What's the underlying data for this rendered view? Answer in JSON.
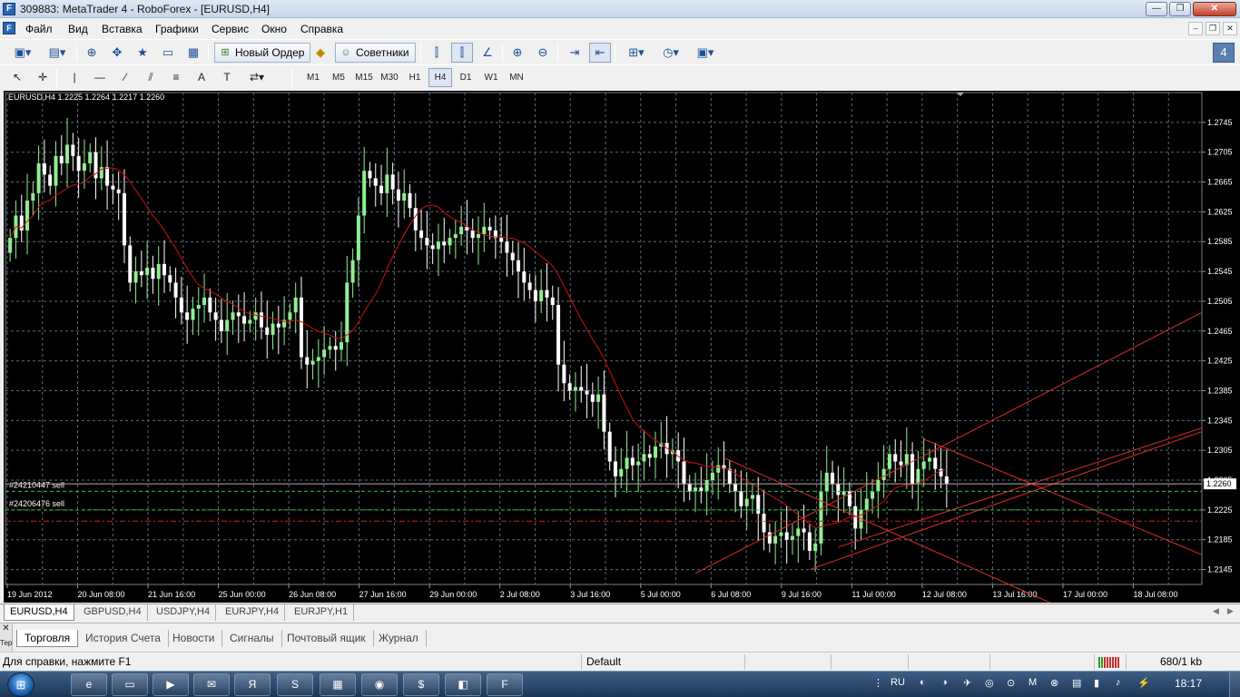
{
  "window": {
    "title": "309883: MetaTrader 4 - RoboForex - [EURUSD,H4]",
    "app_icon": "metatrader-icon"
  },
  "menu": [
    "Файл",
    "Вид",
    "Вставка",
    "Графики",
    "Сервис",
    "Окно",
    "Справка"
  ],
  "toolbar": {
    "new_order_label": "Новый Ордер",
    "advisors_label": "Советники"
  },
  "timeframes": {
    "items": [
      "M1",
      "M5",
      "M15",
      "M30",
      "H1",
      "H4",
      "D1",
      "W1",
      "MN"
    ],
    "active": "H4"
  },
  "chart": {
    "symbol_info": "EURUSD,H4  1.2225 1.2264 1.2217 1.2260",
    "current_price_label": "1.2260",
    "order_labels": [
      "#24210447 sell",
      "#24206476 sell"
    ],
    "colors": {
      "background": "#000000",
      "grid": "#5a6a74",
      "bull_candle": "#90ee90",
      "bear_candle": "#ffffff",
      "moving_average": "#d01010",
      "trendlines": "#dd2a2a",
      "order_line": "#28c03a",
      "stop_line": "#e01a1a",
      "axis_text": "#ffffff"
    }
  },
  "chart_data": {
    "type": "candlestick",
    "title": "EURUSD,H4",
    "ohlc_last": {
      "open": 1.2225,
      "high": 1.2264,
      "low": 1.2217,
      "close": 1.226
    },
    "ylim": [
      1.2125,
      1.2785
    ],
    "y_ticks": [
      "1.2745",
      "1.2705",
      "1.2665",
      "1.2625",
      "1.2585",
      "1.2545",
      "1.2505",
      "1.2465",
      "1.2425",
      "1.2385",
      "1.2345",
      "1.2305",
      "1.2265",
      "1.2225",
      "1.2185",
      "1.2145"
    ],
    "x_ticks": [
      "19 Jun 2012",
      "20 Jun 08:00",
      "21 Jun 16:00",
      "25 Jun 00:00",
      "26 Jun 08:00",
      "27 Jun 16:00",
      "29 Jun 00:00",
      "2 Jul 08:00",
      "3 Jul 16:00",
      "5 Jul 00:00",
      "6 Jul 08:00",
      "9 Jul 16:00",
      "11 Jul 00:00",
      "12 Jul 08:00",
      "13 Jul 16:00",
      "17 Jul 00:00",
      "18 Jul 08:00"
    ],
    "close_series": [
      1.259,
      1.262,
      1.26,
      1.264,
      1.265,
      1.269,
      1.2675,
      1.266,
      1.27,
      1.269,
      1.2715,
      1.27,
      1.268,
      1.269,
      1.2705,
      1.267,
      1.2685,
      1.266,
      1.2655,
      1.265,
      1.258,
      1.253,
      1.2545,
      1.254,
      1.255,
      1.2535,
      1.2555,
      1.254,
      1.253,
      1.251,
      1.249,
      1.248,
      1.2495,
      1.25,
      1.251,
      1.249,
      1.248,
      1.2465,
      1.248,
      1.249,
      1.2485,
      1.2475,
      1.248,
      1.249,
      1.247,
      1.246,
      1.2475,
      1.247,
      1.248,
      1.249,
      1.251,
      1.243,
      1.242,
      1.2425,
      1.243,
      1.244,
      1.2445,
      1.244,
      1.245,
      1.253,
      1.256,
      1.262,
      1.268,
      1.267,
      1.266,
      1.265,
      1.2675,
      1.2655,
      1.264,
      1.265,
      1.263,
      1.26,
      1.259,
      1.258,
      1.2575,
      1.2585,
      1.258,
      1.259,
      1.2595,
      1.2605,
      1.26,
      1.259,
      1.2595,
      1.2605,
      1.26,
      1.259,
      1.2585,
      1.257,
      1.256,
      1.2545,
      1.253,
      1.252,
      1.2505,
      1.252,
      1.251,
      1.25,
      1.242,
      1.2395,
      1.2385,
      1.239,
      1.2385,
      1.238,
      1.237,
      1.238,
      1.233,
      1.229,
      1.227,
      1.228,
      1.2295,
      1.2285,
      1.229,
      1.23,
      1.2295,
      1.231,
      1.2315,
      1.23,
      1.2305,
      1.229,
      1.226,
      1.225,
      1.2255,
      1.225,
      1.2265,
      1.2275,
      1.2285,
      1.228,
      1.226,
      1.225,
      1.223,
      1.224,
      1.2245,
      1.222,
      1.2195,
      1.218,
      1.219,
      1.2195,
      1.2185,
      1.219,
      1.22,
      1.2195,
      1.217,
      1.218,
      1.225,
      1.2275,
      1.226,
      1.2245,
      1.225,
      1.223,
      1.22,
      1.2225,
      1.224,
      1.225,
      1.2265,
      1.228,
      1.23,
      1.229,
      1.2285,
      1.23,
      1.226,
      1.228,
      1.229,
      1.2295,
      1.228,
      1.227,
      1.226
    ],
    "moving_average": {
      "name": "MA",
      "color": "#d01010"
    },
    "trendlines": "5 red trendlines (channel) drawn over last week",
    "horizontal_levels": [
      {
        "label": "#24210447 sell",
        "price": 1.225,
        "style": "dashed",
        "color": "#28c03a"
      },
      {
        "label": "#24206476 sell",
        "price": 1.2225,
        "style": "dashed",
        "color": "#28c03a"
      },
      {
        "price": 1.221,
        "style": "dash-dot",
        "color": "#e01a1a"
      }
    ],
    "grid": true
  },
  "chart_tabs": {
    "items": [
      "EURUSD,H4",
      "GBPUSD,H4",
      "USDJPY,H4",
      "EURJPY,H4",
      "EURJPY,H1"
    ],
    "active": "EURUSD,H4"
  },
  "terminal": {
    "side_label": "Терминал",
    "tabs": [
      "Торговля",
      "История Счета",
      "Новости",
      "Сигналы",
      "Почтовый ящик",
      "Журнал"
    ],
    "active": "Торговля"
  },
  "status": {
    "help": "Для справки, нажмите F1",
    "profile": "Default",
    "traffic": "680/1 kb"
  },
  "taskbar": {
    "apps": [
      "ie-icon",
      "explorer-icon",
      "media-icon",
      "mail-icon",
      "yandex-icon",
      "skype-icon",
      "calculator-icon",
      "chrome-icon",
      "money-icon",
      "app-icon",
      "metatrader-icon"
    ],
    "lang": "RU",
    "clock": "18:17"
  }
}
